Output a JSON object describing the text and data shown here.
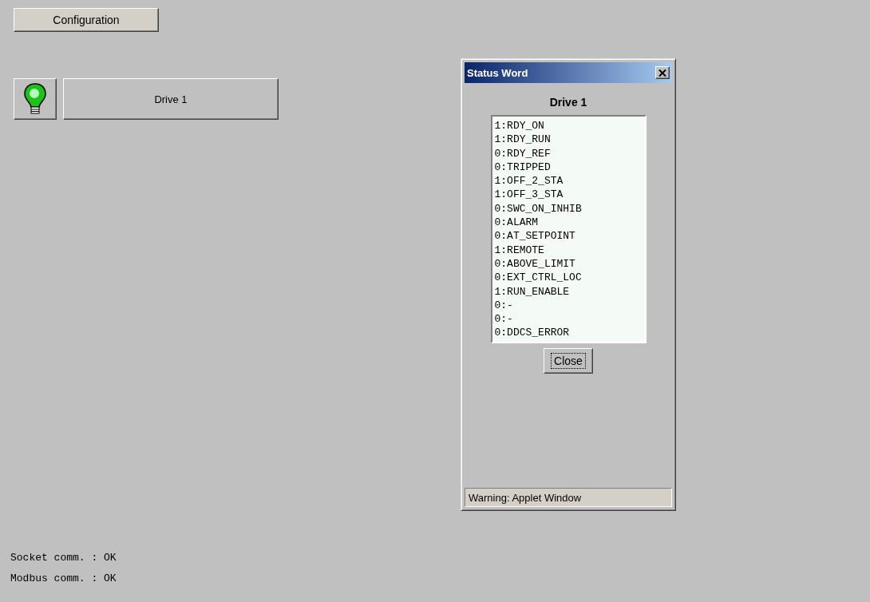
{
  "config_button": {
    "label": "Configuration"
  },
  "drive": {
    "lamp_on": true,
    "label": "Drive 1"
  },
  "dialog": {
    "title": "Status Word",
    "heading": "Drive 1",
    "bits": [
      "1:RDY_ON",
      "1:RDY_RUN",
      "0:RDY_REF",
      "0:TRIPPED",
      "1:OFF_2_STA",
      "1:OFF_3_STA",
      "0:SWC_ON_INHIB",
      "0:ALARM",
      "0:AT_SETPOINT",
      "1:REMOTE",
      "0:ABOVE_LIMIT",
      "0:EXT_CTRL_LOC",
      "1:RUN_ENABLE",
      "0:-",
      "0:-",
      "0:DDCS_ERROR"
    ],
    "close_button": {
      "label": "Close",
      "focused": true
    },
    "status_bar": "Warning: Applet Window"
  },
  "status_lines": [
    "Socket comm. : OK",
    "Modbus comm. : OK"
  ]
}
